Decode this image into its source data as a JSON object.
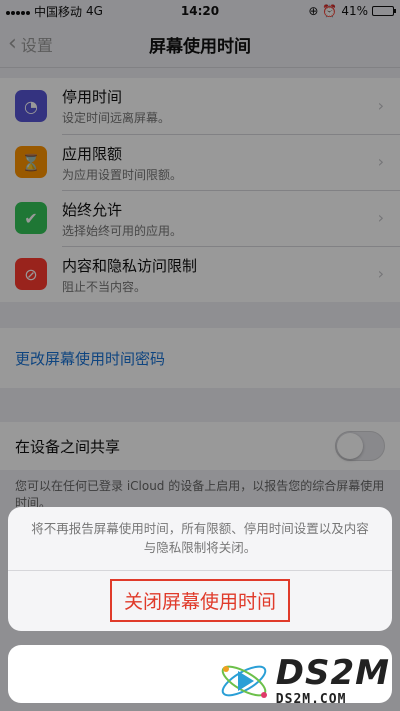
{
  "status_bar": {
    "carrier": "中国移动",
    "network": "4G",
    "time": "14:20",
    "battery_percent": "41%",
    "battery_level": 0.41
  },
  "nav": {
    "back_label": "设置",
    "title": "屏幕使用时间"
  },
  "settings_rows": [
    {
      "title": "停用时间",
      "subtitle": "设定时间远离屏幕。",
      "icon": "downtime-icon",
      "color": "#5856d6"
    },
    {
      "title": "应用限额",
      "subtitle": "为应用设置时间限额。",
      "icon": "hourglass-icon",
      "color": "#ff9500"
    },
    {
      "title": "始终允许",
      "subtitle": "选择始终可用的应用。",
      "icon": "checkmark-badge-icon",
      "color": "#34c759"
    },
    {
      "title": "内容和隐私访问限制",
      "subtitle": "阻止不当内容。",
      "icon": "restriction-icon",
      "color": "#ff3b30"
    }
  ],
  "passcode_link": "更改屏幕使用时间密码",
  "share": {
    "label": "在设备之间共享",
    "footnote": "您可以在任何已登录 iCloud 的设备上启用，以报告您的综合屏幕使用时间。"
  },
  "action_sheet": {
    "message": "将不再报告屏幕使用时间，所有限额、停用时间设置以及内容与隐私限制将关闭。",
    "action_label": "关闭屏幕使用时间"
  },
  "watermark": {
    "big": "DS2M",
    "small": "DS2M.COM"
  }
}
